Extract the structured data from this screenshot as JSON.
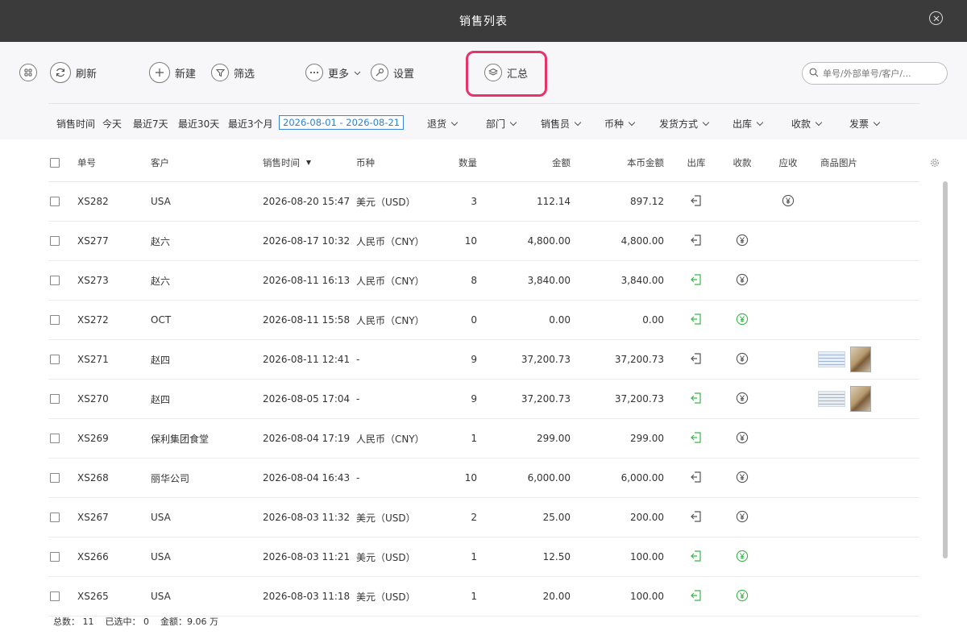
{
  "window": {
    "title": "销售列表"
  },
  "toolbar": {
    "refresh": "刷新",
    "new": "新建",
    "filter": "筛选",
    "more": "更多",
    "settings": "设置",
    "summary": "汇总"
  },
  "search": {
    "placeholder": "单号/外部单号/客户/..."
  },
  "filters": {
    "label": "销售时间",
    "today": "今天",
    "last7": "最近7天",
    "last30": "最近30天",
    "last3m": "最近3个月",
    "date_range": "2026-08-01 - 2026-08-21",
    "dropdowns": [
      "退货",
      "部门",
      "销售员",
      "币种",
      "发货方式",
      "出库",
      "收款",
      "发票"
    ]
  },
  "table": {
    "columns": [
      "单号",
      "客户",
      "销售时间",
      "币种",
      "数量",
      "金额",
      "本币金额",
      "出库",
      "收款",
      "应收",
      "商品图片"
    ],
    "rows": [
      {
        "id": "XS282",
        "customer": "USA",
        "time": "2026-08-20 15:47",
        "currency": "美元（USD）",
        "qty": "3",
        "amount": "112.14",
        "local_amount": "897.12",
        "out_status": "pending",
        "pay_status": "none",
        "recv_status": "pending",
        "images": false
      },
      {
        "id": "XS277",
        "customer": "赵六",
        "time": "2026-08-17 10:32",
        "currency": "人民币（CNY）",
        "qty": "10",
        "amount": "4,800.00",
        "local_amount": "4,800.00",
        "out_status": "pending",
        "pay_status": "pending",
        "recv_status": "none",
        "images": false
      },
      {
        "id": "XS273",
        "customer": "赵六",
        "time": "2026-08-11 16:13",
        "currency": "人民币（CNY）",
        "qty": "8",
        "amount": "3,840.00",
        "local_amount": "3,840.00",
        "out_status": "done",
        "pay_status": "pending",
        "recv_status": "none",
        "images": false
      },
      {
        "id": "XS272",
        "customer": "OCT",
        "time": "2026-08-11 15:58",
        "currency": "人民币（CNY）",
        "qty": "0",
        "amount": "0.00",
        "local_amount": "0.00",
        "out_status": "done",
        "pay_status": "done",
        "recv_status": "none",
        "images": false
      },
      {
        "id": "XS271",
        "customer": "赵四",
        "time": "2026-08-11 12:41",
        "currency": "-",
        "qty": "9",
        "amount": "37,200.73",
        "local_amount": "37,200.73",
        "out_status": "pending",
        "pay_status": "pending",
        "recv_status": "none",
        "images": true
      },
      {
        "id": "XS270",
        "customer": "赵四",
        "time": "2026-08-05 17:04",
        "currency": "-",
        "qty": "9",
        "amount": "37,200.73",
        "local_amount": "37,200.73",
        "out_status": "done",
        "pay_status": "pending",
        "recv_status": "none",
        "images": true
      },
      {
        "id": "XS269",
        "customer": "保利集团食堂",
        "time": "2026-08-04 17:19",
        "currency": "人民币（CNY）",
        "qty": "1",
        "amount": "299.00",
        "local_amount": "299.00",
        "out_status": "done",
        "pay_status": "pending",
        "recv_status": "none",
        "images": false
      },
      {
        "id": "XS268",
        "customer": "丽华公司",
        "time": "2026-08-04 16:43",
        "currency": "-",
        "qty": "10",
        "amount": "6,000.00",
        "local_amount": "6,000.00",
        "out_status": "pending",
        "pay_status": "pending",
        "recv_status": "none",
        "images": false
      },
      {
        "id": "XS267",
        "customer": "USA",
        "time": "2026-08-03 11:32",
        "currency": "美元（USD）",
        "qty": "2",
        "amount": "25.00",
        "local_amount": "200.00",
        "out_status": "pending",
        "pay_status": "pending",
        "recv_status": "none",
        "images": false
      },
      {
        "id": "XS266",
        "customer": "USA",
        "time": "2026-08-03 11:21",
        "currency": "美元（USD）",
        "qty": "1",
        "amount": "12.50",
        "local_amount": "100.00",
        "out_status": "done",
        "pay_status": "done",
        "recv_status": "none",
        "images": false
      },
      {
        "id": "XS265",
        "customer": "USA",
        "time": "2026-08-03 11:18",
        "currency": "美元（USD）",
        "qty": "1",
        "amount": "20.00",
        "local_amount": "100.00",
        "out_status": "done",
        "pay_status": "done",
        "recv_status": "none",
        "images": false
      }
    ]
  },
  "footer": {
    "total": "总数：  11",
    "selected": "已选中：  0",
    "amount": "金额：9.06 万"
  },
  "colors": {
    "done": "#3ab54a",
    "pending": "#555555",
    "highlight": "#e8336a",
    "link": "#2f7fd3"
  }
}
